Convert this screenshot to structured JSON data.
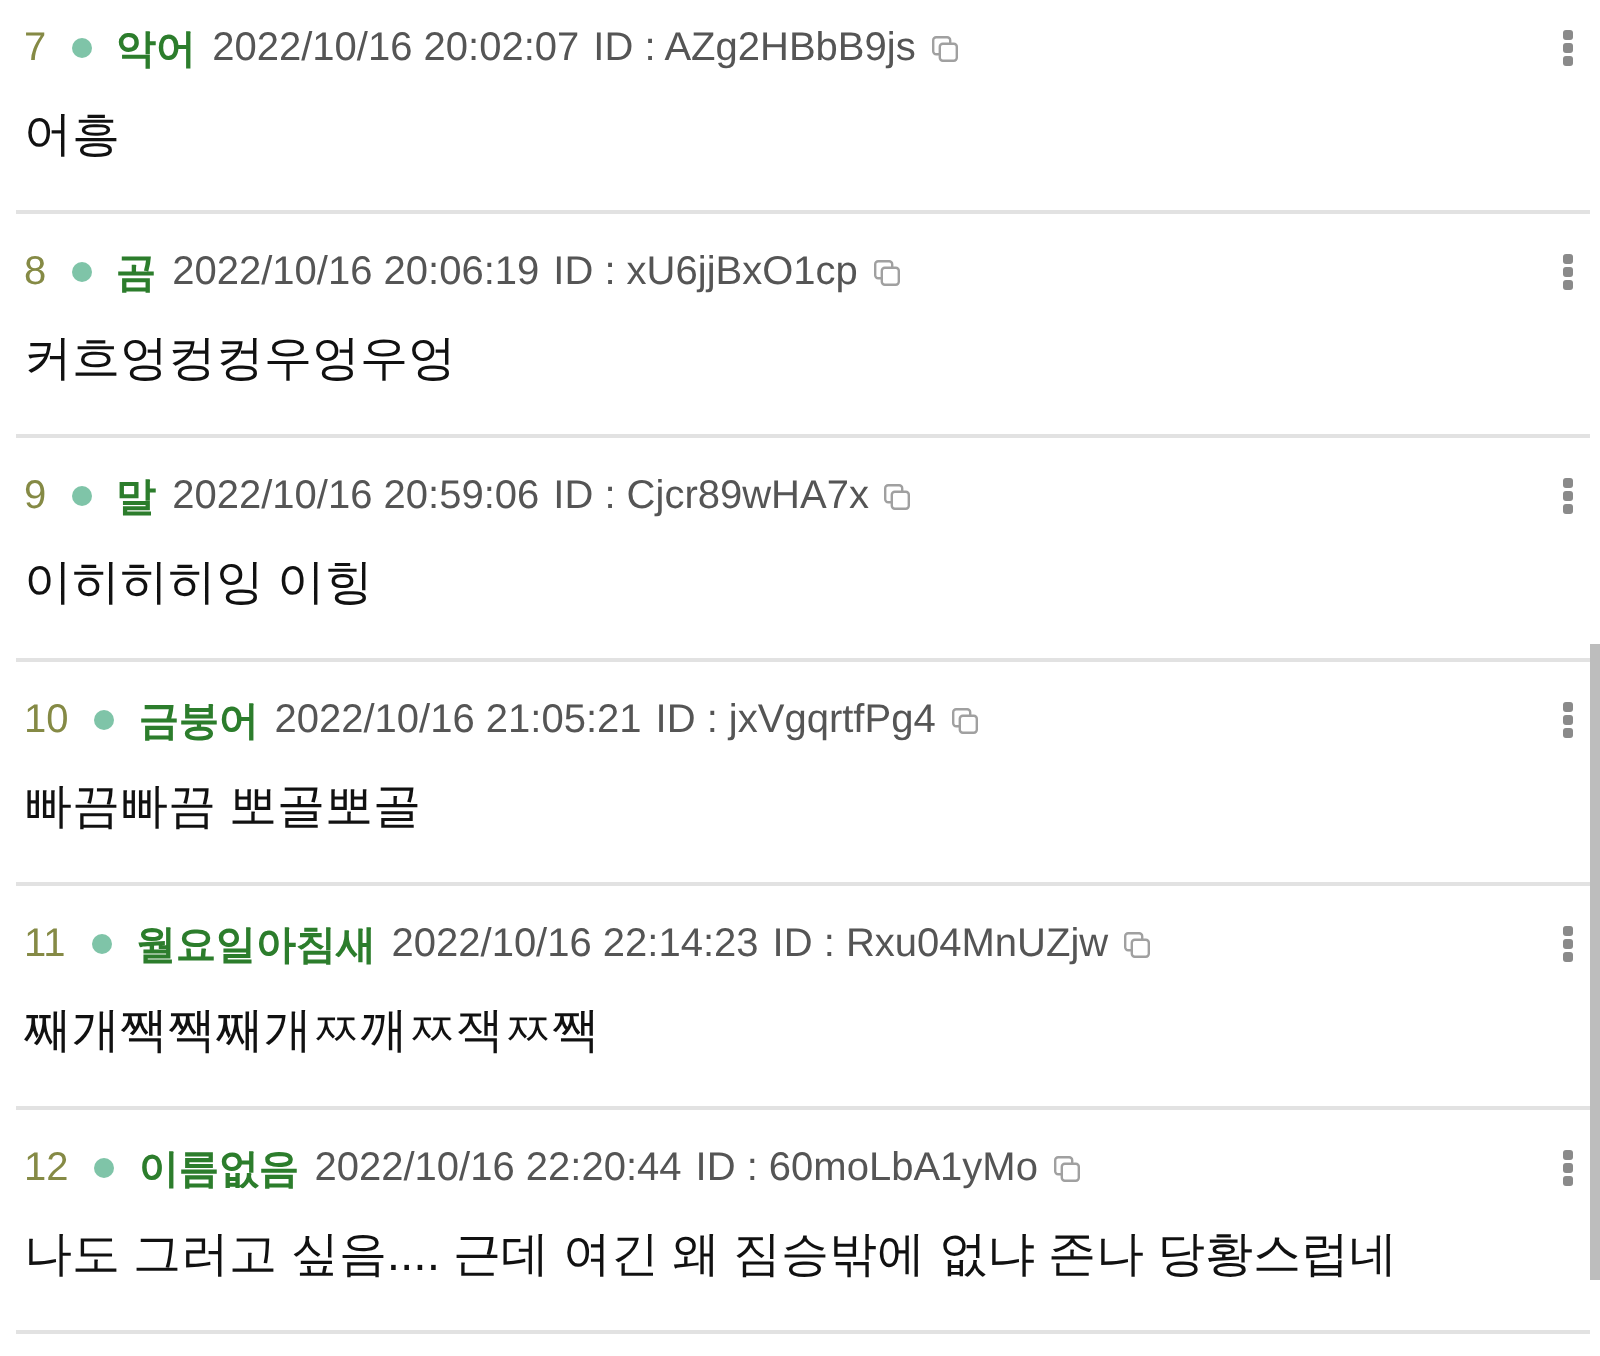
{
  "posts": [
    {
      "number": "7",
      "name": "악어",
      "datetime": "2022/10/16 20:02:07",
      "id": "ID : AZg2HBbB9js",
      "body": "어흥"
    },
    {
      "number": "8",
      "name": "곰",
      "datetime": "2022/10/16 20:06:19",
      "id": "ID : xU6jjBxO1cp",
      "body": "커흐엉컹컹우엉우엉"
    },
    {
      "number": "9",
      "name": "말",
      "datetime": "2022/10/16 20:59:06",
      "id": "ID : Cjcr89wHA7x",
      "body": "이히히히잉 이힝"
    },
    {
      "number": "10",
      "name": "금붕어",
      "datetime": "2022/10/16 21:05:21",
      "id": "ID : jxVgqrtfPg4",
      "body": "빠끔빠끔 뽀골뽀골"
    },
    {
      "number": "11",
      "name": "월요일아침새",
      "datetime": "2022/10/16 22:14:23",
      "id": "ID : Rxu04MnUZjw",
      "body": "째개짹짹째개ㅉ깨ㅉ잭ㅉ짹"
    },
    {
      "number": "12",
      "name": "이름없음",
      "datetime": "2022/10/16 22:20:44",
      "id": "ID : 60moLbA1yMo",
      "body": "나도 그러고 싶음.... 근데 여긴 왜 짐승밖에 없냐 존나 당황스럽네"
    }
  ]
}
